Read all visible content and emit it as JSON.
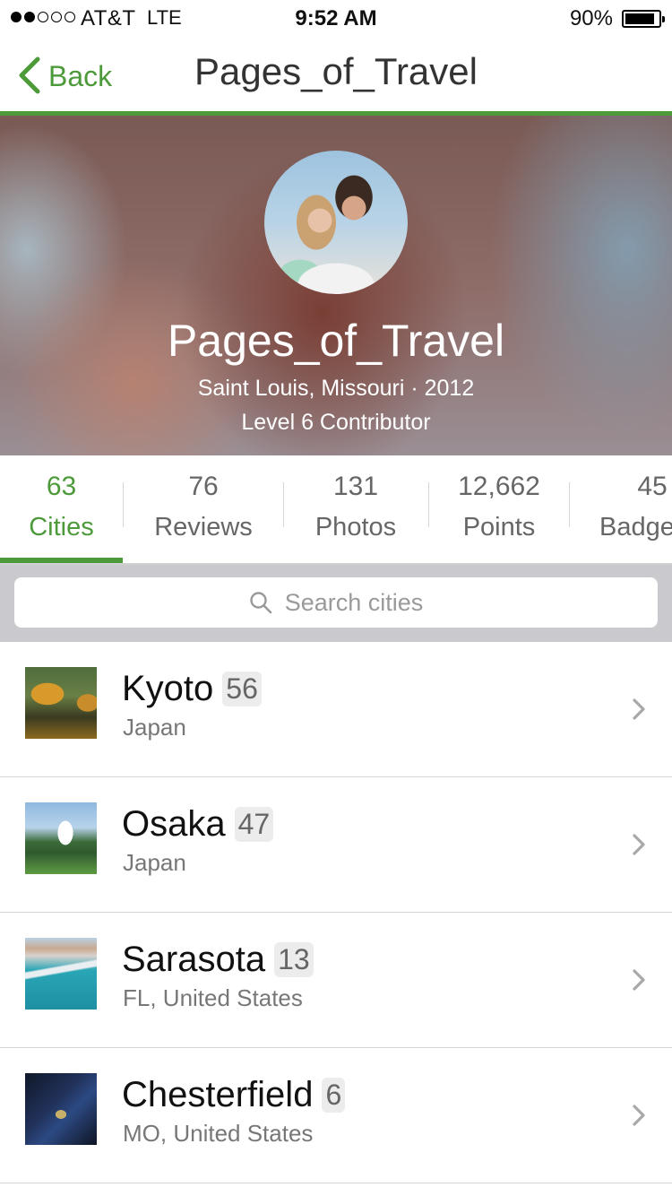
{
  "status_bar": {
    "signal_filled": 2,
    "signal_total": 5,
    "carrier": "AT&T",
    "network": "LTE",
    "time": "9:52 AM",
    "battery_percent": "90%",
    "battery_level": 0.9
  },
  "nav": {
    "back_label": "Back",
    "title": "Pages_of_Travel"
  },
  "profile": {
    "name": "Pages_of_Travel",
    "meta": "Saint Louis, Missouri · 2012",
    "level": "Level 6 Contributor"
  },
  "stats": [
    {
      "count": "63",
      "label": "Cities"
    },
    {
      "count": "76",
      "label": "Reviews"
    },
    {
      "count": "131",
      "label": "Photos"
    },
    {
      "count": "12,662",
      "label": "Points"
    },
    {
      "count": "45",
      "label": "Badges"
    }
  ],
  "search": {
    "placeholder": "Search cities",
    "icon": "search-icon"
  },
  "cities": [
    {
      "name": "Kyoto",
      "count": "56",
      "region": "Japan"
    },
    {
      "name": "Osaka",
      "count": "47",
      "region": "Japan"
    },
    {
      "name": "Sarasota",
      "count": "13",
      "region": "FL, United States"
    },
    {
      "name": "Chesterfield",
      "count": "6",
      "region": "MO, United States"
    }
  ],
  "colors": {
    "accent": "#4d9a3a",
    "search_background": "#c9c9ce"
  }
}
